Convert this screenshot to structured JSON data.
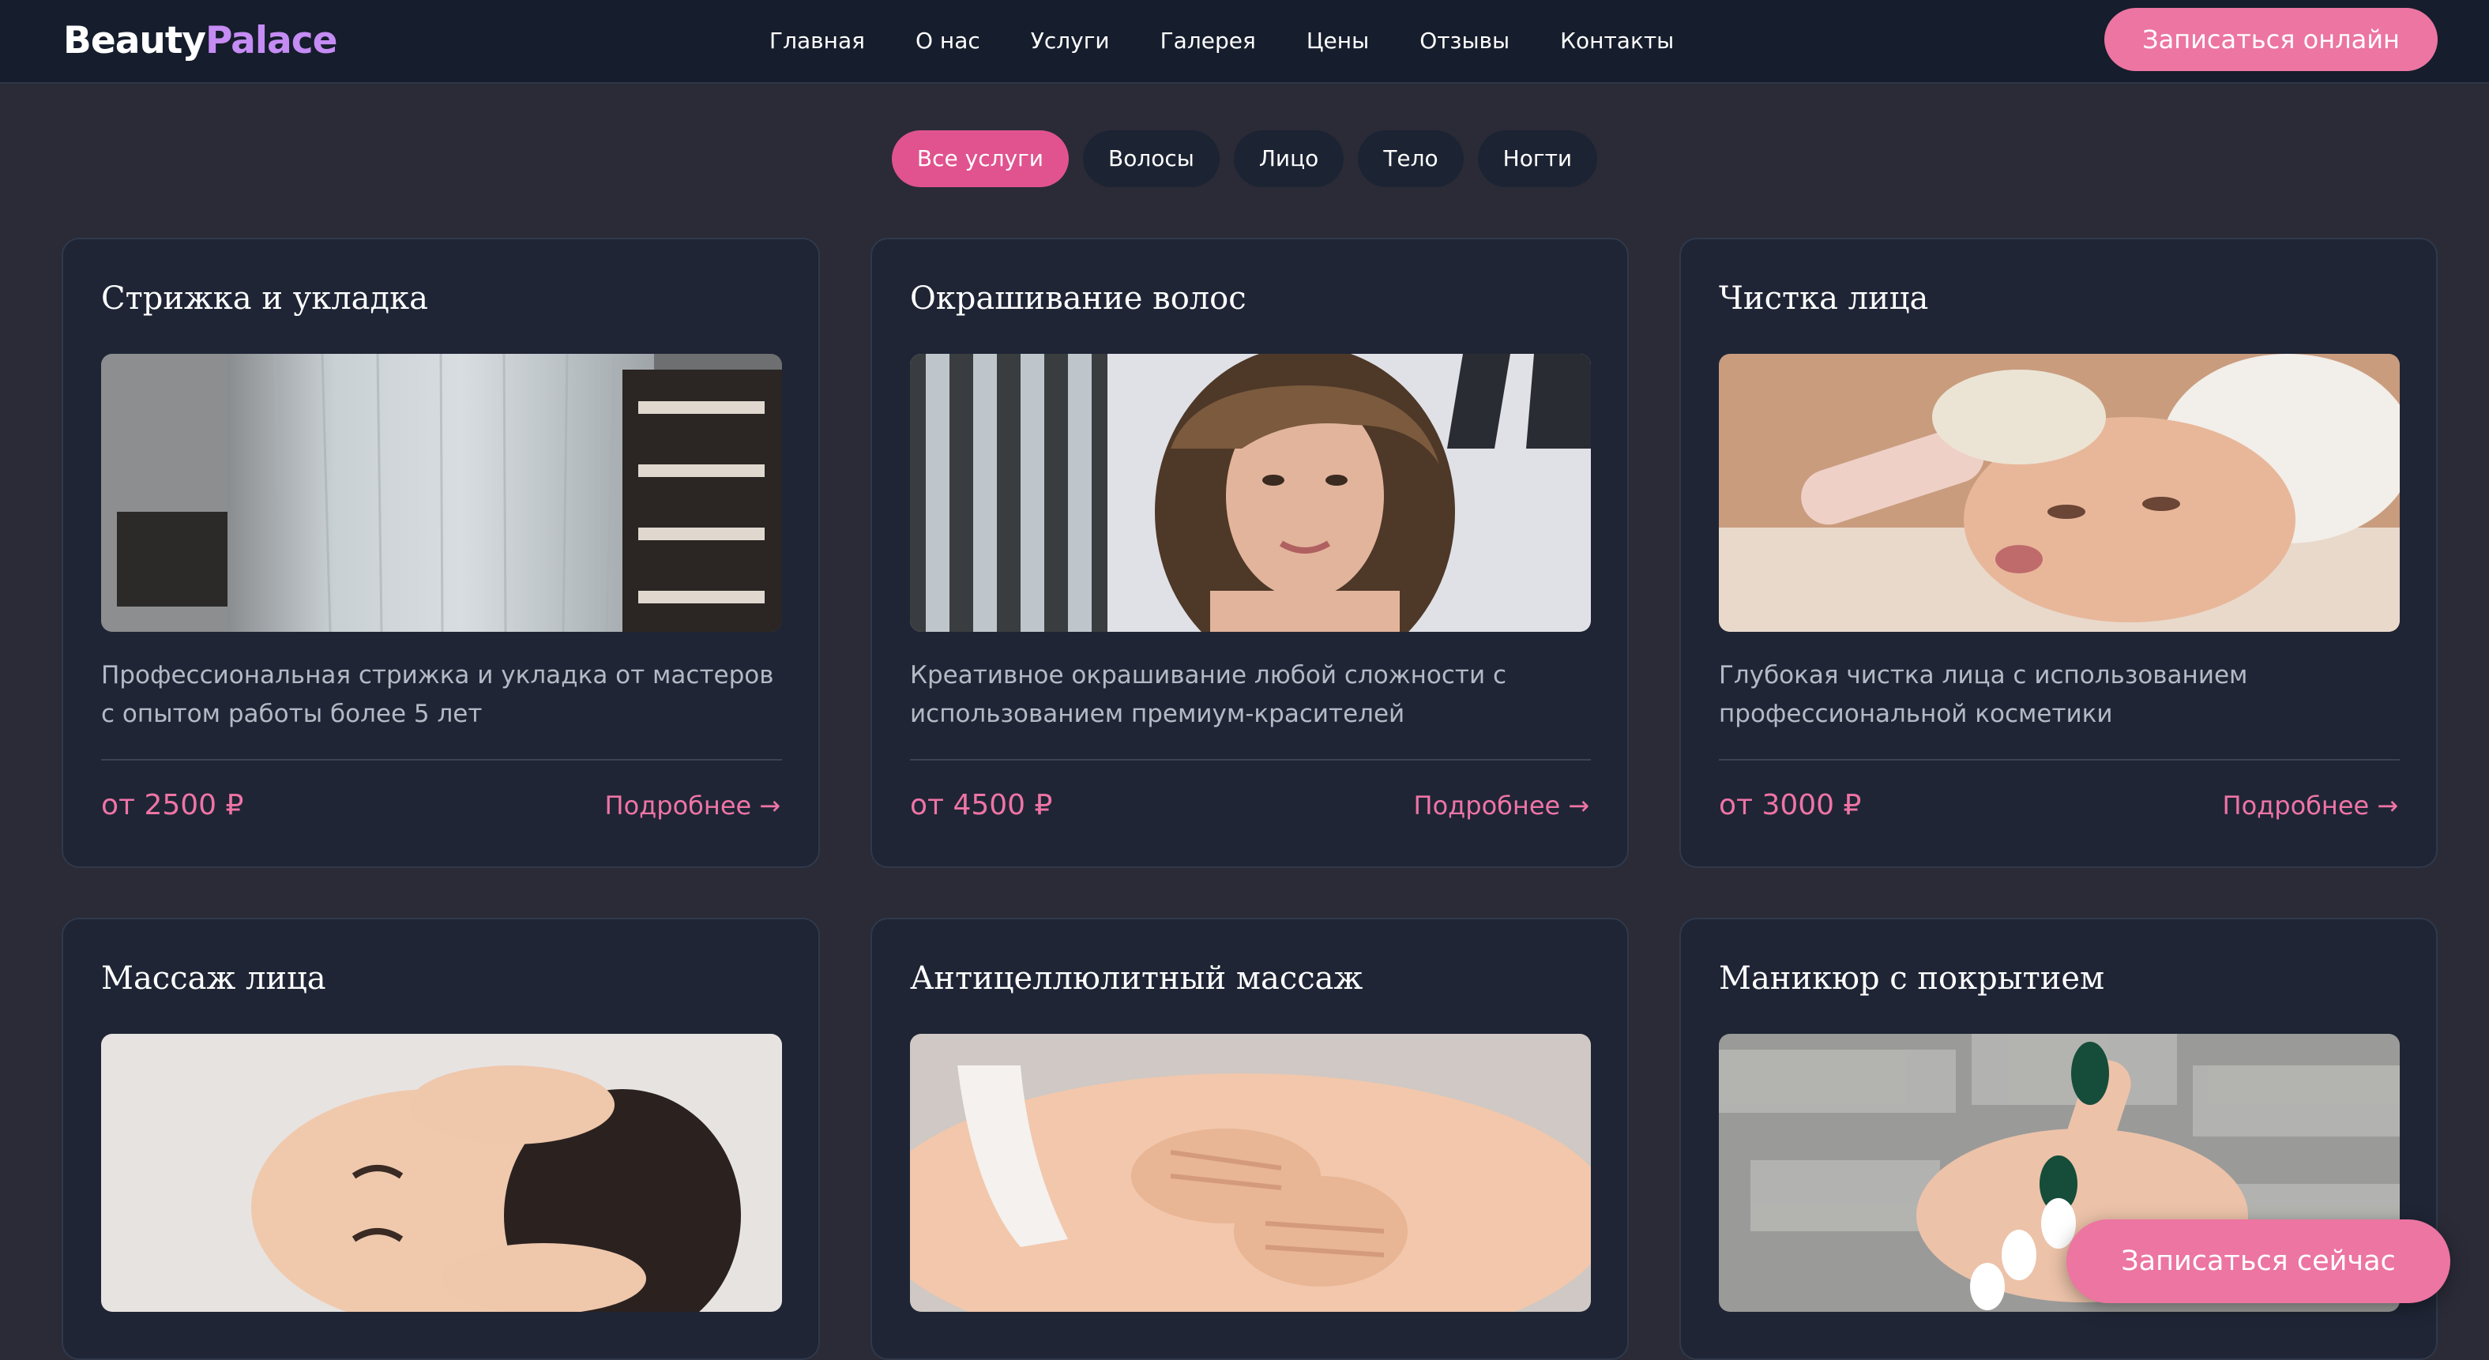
{
  "brand": {
    "part1": "Beauty",
    "part2": "Palace"
  },
  "nav": [
    {
      "label": "Главная"
    },
    {
      "label": "О нас"
    },
    {
      "label": "Услуги"
    },
    {
      "label": "Галерея"
    },
    {
      "label": "Цены"
    },
    {
      "label": "Отзывы"
    },
    {
      "label": "Контакты"
    }
  ],
  "header": {
    "book_label": "Записаться онлайн"
  },
  "filters": [
    {
      "label": "Все услуги",
      "active": true
    },
    {
      "label": "Волосы",
      "active": false
    },
    {
      "label": "Лицо",
      "active": false
    },
    {
      "label": "Тело",
      "active": false
    },
    {
      "label": "Ногти",
      "active": false
    }
  ],
  "services": [
    {
      "title": "Стрижка и укладка",
      "description": "Профессиональная стрижка и укладка от мастеров с опытом работы более 5 лет",
      "price": "от 2500 ₽",
      "more": "Подробнее"
    },
    {
      "title": "Окрашивание волос",
      "description": "Креативное окрашивание любой сложности с использованием премиум-красителей",
      "price": "от 4500 ₽",
      "more": "Подробнее"
    },
    {
      "title": "Чистка лица",
      "description": "Глубокая чистка лица с использованием профессиональной косметики",
      "price": "от 3000 ₽",
      "more": "Подробнее"
    },
    {
      "title": "Массаж лица"
    },
    {
      "title": "Антицеллюлитный массаж"
    },
    {
      "title": "Маникюр с покрытием"
    }
  ],
  "cta": {
    "label": "Записаться сейчас"
  },
  "colors": {
    "accent": "#ec75a2",
    "accent_text": "#ef74a6",
    "brand_purple": "#c58cf4",
    "header_bg": "#161d2c",
    "page_bg": "#2a2b37",
    "card_bg": "#1f2535"
  }
}
